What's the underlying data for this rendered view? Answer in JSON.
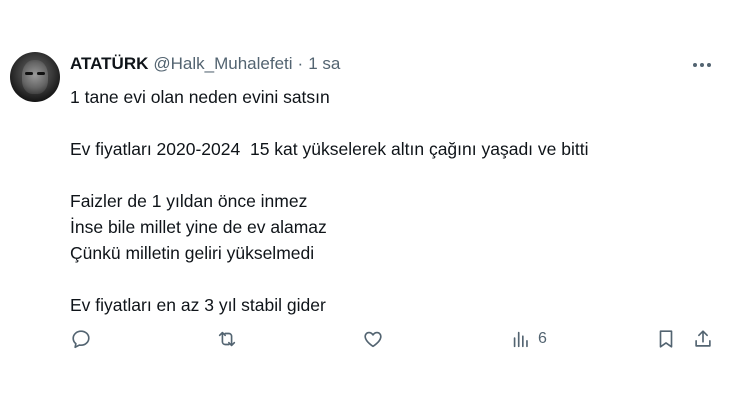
{
  "author": {
    "name": "ATATÜRK",
    "handle": "@Halk_Muhalefeti",
    "separator": "·",
    "time": "1 sa"
  },
  "tweet": {
    "lines": [
      "1 tane evi olan neden evini satsın",
      "",
      "Ev fiyatları 2020-2024  15 kat yükselerek altın çağını yaşadı ve bitti",
      "",
      "Faizler de 1 yıldan önce inmez",
      "İnse bile millet yine de ev alamaz",
      "Çünkü milletin geliri yükselmedi",
      "",
      "Ev fiyatları en az 3 yıl stabil gider"
    ]
  },
  "actions": {
    "reply": {
      "icon": "reply-icon",
      "count": ""
    },
    "retweet": {
      "icon": "retweet-icon",
      "count": ""
    },
    "like": {
      "icon": "heart-icon",
      "count": ""
    },
    "views": {
      "icon": "views-icon",
      "count": "6"
    },
    "bookmark": {
      "icon": "bookmark-icon"
    },
    "share": {
      "icon": "share-icon"
    }
  },
  "colors": {
    "text": "#0f1419",
    "secondary": "#536471",
    "background": "#ffffff"
  }
}
